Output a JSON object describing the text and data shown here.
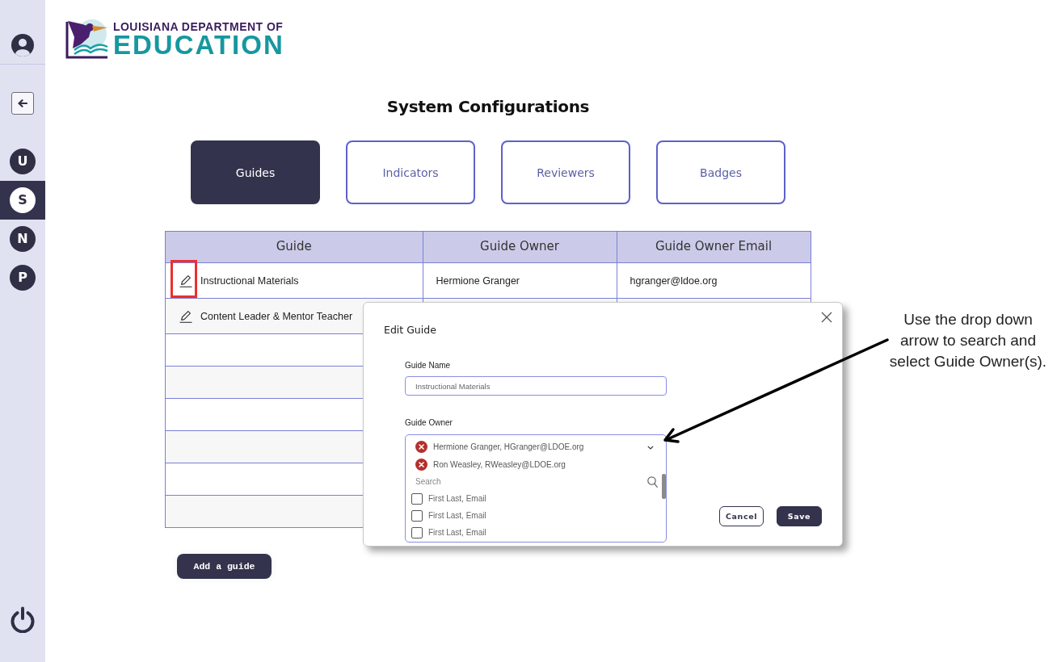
{
  "sidebar": {
    "items": [
      {
        "label": "U",
        "selected": false
      },
      {
        "label": "S",
        "selected": true
      },
      {
        "label": "N",
        "selected": false
      },
      {
        "label": "P",
        "selected": false
      }
    ]
  },
  "logo": {
    "line_1": "LOUISIANA DEPARTMENT OF",
    "line_2": "EDUCATION"
  },
  "page_title": "System Configurations",
  "tabs": [
    {
      "label": "Guides",
      "selected": true
    },
    {
      "label": "Indicators",
      "selected": false
    },
    {
      "label": "Reviewers",
      "selected": false
    },
    {
      "label": "Badges",
      "selected": false
    }
  ],
  "table": {
    "columns": [
      "Guide",
      "Guide Owner",
      "Guide Owner Email"
    ],
    "rows": [
      {
        "guide": "Instructional Materials",
        "owner": "Hermione Granger",
        "email": "hgranger@ldoe.org",
        "highlighted": true
      },
      {
        "guide": "Content Leader & Mentor Teacher",
        "highlighted": false
      }
    ]
  },
  "add_button": "Add a guide",
  "dialog": {
    "title": "Edit Guide",
    "guide_name": {
      "label": "Guide Name",
      "value": "Instructional Materials"
    },
    "guide_owner": {
      "label": "Guide Owner",
      "chips": [
        "Hermione Granger, HGranger@LDOE.org",
        "Ron Weasley, RWeasley@LDOE.org"
      ],
      "search": {
        "placeholder": "Search"
      },
      "options": [
        {
          "label": "First Last, Email",
          "checked": false
        },
        {
          "label": "First Last, Email",
          "checked": false
        },
        {
          "label": "First Last, Email",
          "checked": false
        }
      ]
    },
    "buttons": [
      {
        "label": "Cancel",
        "kind": "secondary"
      },
      {
        "label": "Save",
        "kind": "primary"
      }
    ]
  },
  "callout": {
    "lines": [
      "Use the drop down",
      "arrow to search and",
      "select Guide Owner(s)."
    ]
  }
}
